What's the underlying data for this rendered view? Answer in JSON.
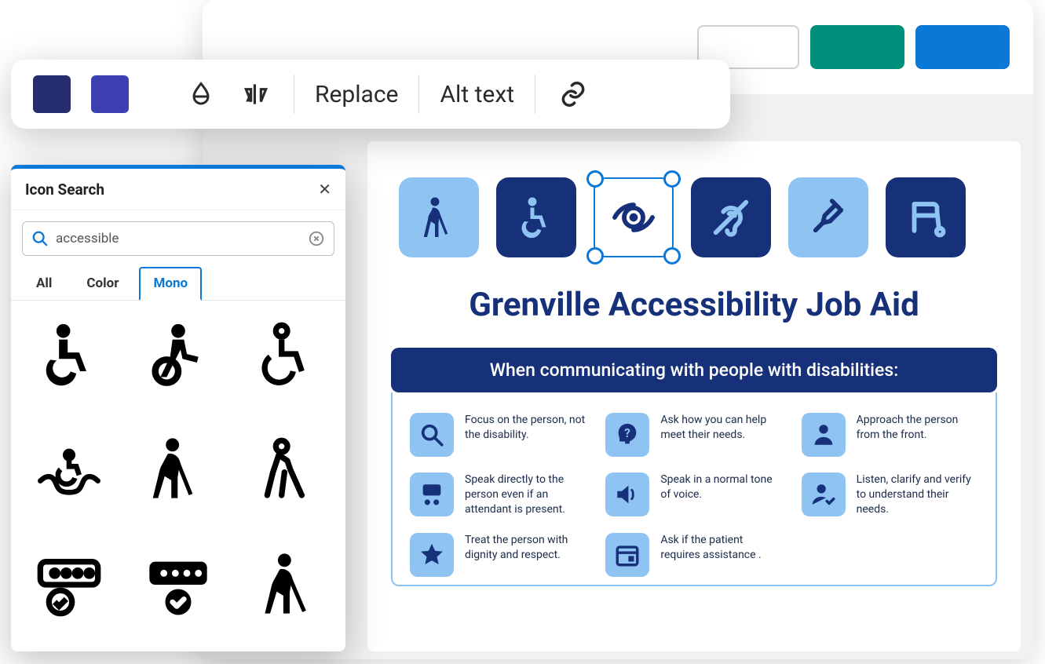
{
  "colors": {
    "swatch1": "#262d6e",
    "swatch2": "#3b3fb0",
    "accent": "#0a78d6",
    "tile_light": "#8fc3f2",
    "tile_dark": "#17307a",
    "header_green": "#008f7a",
    "header_blue": "#0a78d6"
  },
  "toolbar": {
    "replace_label": "Replace",
    "alt_text_label": "Alt text"
  },
  "icon_search": {
    "title": "Icon Search",
    "query": "accessible",
    "tabs": {
      "all": "All",
      "color": "Color",
      "mono": "Mono"
    },
    "active_tab": "Mono",
    "results": [
      "wheelchair-solid-icon",
      "wheelchair-person-icon",
      "wheelchair-outline-icon",
      "accessible-hands-icon",
      "cane-walk-solid-icon",
      "cane-walk-outline-icon",
      "password-check-outline-icon",
      "password-check-solid-icon",
      "cane-walk-alt-icon"
    ]
  },
  "document": {
    "title": "Grenville Accessibility Job Aid",
    "banner": "When communicating with people with disabilities:",
    "header_icons": [
      "blind-person-icon",
      "wheelchair-icon",
      "low-vision-icon",
      "deaf-icon",
      "crutch-icon",
      "walker-icon"
    ],
    "selected_header_icon_index": 2,
    "tips": [
      {
        "icon": "magnifier-icon",
        "text": "Focus on the person, not the disability."
      },
      {
        "icon": "question-head-icon",
        "text": "Ask how you can help meet their needs."
      },
      {
        "icon": "person-front-icon",
        "text": "Approach the person from the front."
      },
      {
        "icon": "speak-direct-icon",
        "text": "Speak directly to the person even if an attendant is present."
      },
      {
        "icon": "speaker-icon",
        "text": "Speak in a normal tone of voice."
      },
      {
        "icon": "person-check-icon",
        "text": "Listen, clarify and verify to understand their needs."
      },
      {
        "icon": "star-icon",
        "text": "Treat the person with dignity and respect."
      },
      {
        "icon": "calendar-icon",
        "text": "Ask if the patient requires assistance ."
      }
    ]
  }
}
